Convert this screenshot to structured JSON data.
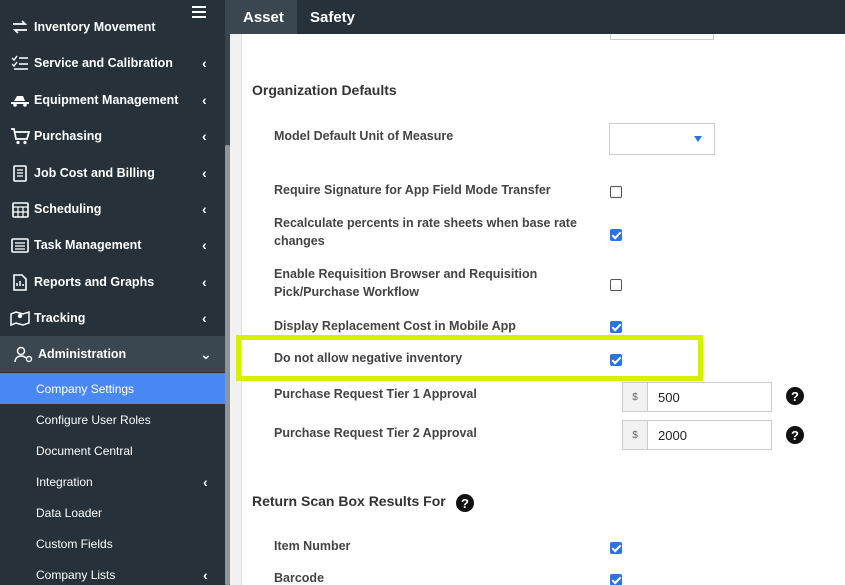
{
  "sidebar": {
    "items": [
      {
        "label": "Inventory Movement",
        "icon": "arrows-exchange-icon"
      },
      {
        "label": "Service and Calibration",
        "icon": "checklist-icon"
      },
      {
        "label": "Equipment Management",
        "icon": "truck-icon"
      },
      {
        "label": "Purchasing",
        "icon": "cart-icon"
      },
      {
        "label": "Job Cost and Billing",
        "icon": "receipt-icon"
      },
      {
        "label": "Scheduling",
        "icon": "calendar-icon"
      },
      {
        "label": "Task Management",
        "icon": "list-icon"
      },
      {
        "label": "Reports and Graphs",
        "icon": "report-icon"
      },
      {
        "label": "Tracking",
        "icon": "map-icon"
      },
      {
        "label": "Administration",
        "icon": "user-gear-icon"
      }
    ],
    "admin_subitems": [
      {
        "label": "Company Settings"
      },
      {
        "label": "Configure User Roles"
      },
      {
        "label": "Document Central"
      },
      {
        "label": "Integration"
      },
      {
        "label": "Data Loader"
      },
      {
        "label": "Custom Fields"
      },
      {
        "label": "Company Lists"
      }
    ]
  },
  "tabs": [
    {
      "label": "Asset"
    },
    {
      "label": "Safety"
    }
  ],
  "main": {
    "org_defaults_title": "Organization Defaults",
    "model_uom_label": "Model Default Unit of Measure",
    "settings": [
      {
        "label": "Require Signature for App Field Mode Transfer",
        "checked": false
      },
      {
        "label": "Recalculate percents in rate sheets when base rate changes",
        "checked": true
      },
      {
        "label": "Enable Requisition Browser and Requisition Pick/Purchase Workflow",
        "checked": false
      },
      {
        "label": "Display Replacement Cost in Mobile App",
        "checked": true
      },
      {
        "label": "Do not allow negative inventory",
        "checked": true
      }
    ],
    "tier1": {
      "label": "Purchase Request Tier 1 Approval",
      "currency": "$",
      "value": "500"
    },
    "tier2": {
      "label": "Purchase Request Tier 2 Approval",
      "currency": "$",
      "value": "2000"
    },
    "return_scan_title": "Return Scan Box Results For",
    "return_scan_items": [
      {
        "label": "Item Number",
        "checked": true
      },
      {
        "label": "Barcode",
        "checked": true
      }
    ]
  },
  "colors": {
    "sidebar_bg": "#26313a",
    "selected_bg": "#4a89f3",
    "checkbox_on": "#2b73e0",
    "highlight": "#d6f000"
  }
}
